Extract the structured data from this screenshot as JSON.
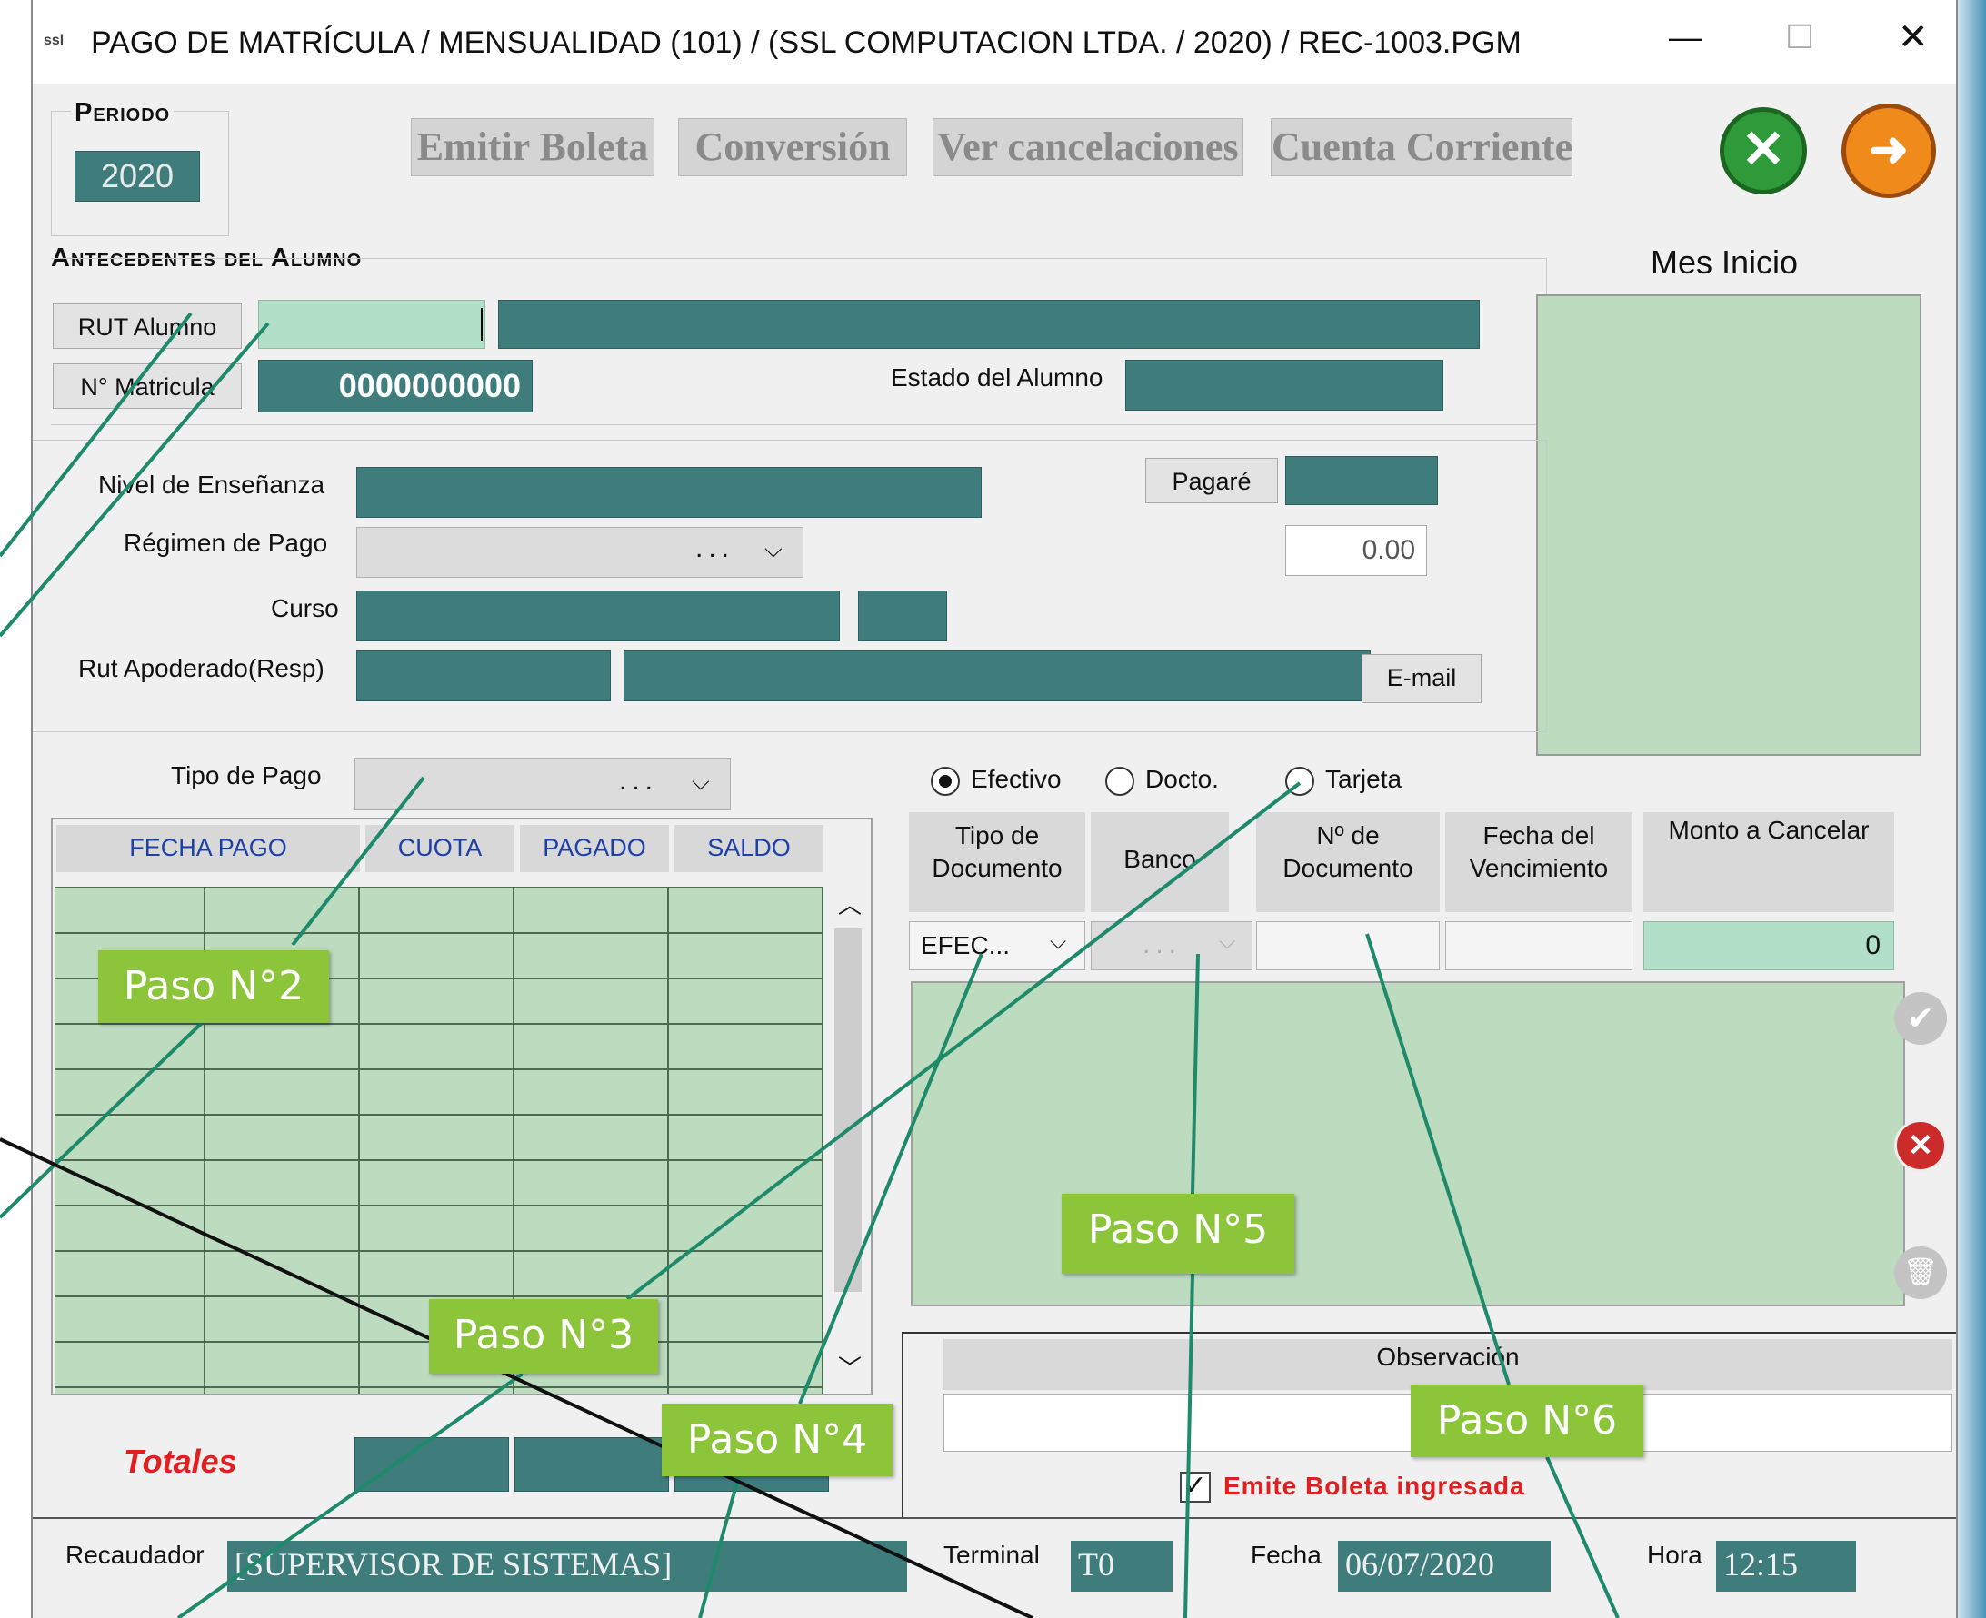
{
  "window": {
    "title": "PAGO DE MATRÍCULA / MENSUALIDAD (101) / (SSL COMPUTACION LTDA. / 2020) / REC-1003.PGM",
    "app_icon": "ssl-logo-icon",
    "controls": {
      "minimize": "—",
      "maximize": "☐",
      "close": "✕"
    }
  },
  "periodo": {
    "label": "Periodo",
    "value": "2020"
  },
  "toolbar": {
    "emitir_boleta": "Emitir Boleta",
    "conversion": "Conversión",
    "ver_cancelaciones": "Ver cancelaciones",
    "cuenta_corriente": "Cuenta Corriente"
  },
  "antecedentes": {
    "title": "Antecedentes del Alumno",
    "rut_label": "RUT Alumno",
    "rut_value": "",
    "matricula_label": "N° Matricula",
    "matricula_value": "0000000000",
    "estado_label": "Estado del Alumno"
  },
  "mes_inicio": {
    "label": "Mes Inicio"
  },
  "detalle": {
    "nivel_label": "Nivel de Enseñanza",
    "regimen_label": "Régimen de Pago",
    "regimen_value": "...",
    "curso_label": "Curso",
    "apoderado_label": "Rut Apoderado(Resp)",
    "pagare_label": "Pagaré",
    "monto_pagare": "0.00",
    "email_label": "E-mail"
  },
  "tipo_pago": {
    "label": "Tipo de Pago",
    "value": "..."
  },
  "cuotas_grid": {
    "headers": [
      "FECHA PAGO",
      "CUOTA",
      "PAGADO",
      "SALDO"
    ]
  },
  "totales_label": "Totales",
  "forma_pago": {
    "options": [
      "Efectivo",
      "Docto.",
      "Tarjeta"
    ],
    "selected": "Efectivo"
  },
  "documento": {
    "headers": [
      "Tipo de Documento",
      "Banco",
      "Nº de Documento",
      "Fecha del Vencimiento",
      "Monto a Cancelar"
    ],
    "tipo_value": "EFEC...",
    "banco_value": "...",
    "monto_value": "0"
  },
  "observacion": {
    "label": "Observación",
    "emite_boleta": "Emite Boleta ingresada"
  },
  "status_bar": {
    "recaudador_label": "Recaudador",
    "recaudador_value": "[SUPERVISOR DE SISTEMAS]",
    "terminal_label": "Terminal",
    "terminal_value": "T0",
    "fecha_label": "Fecha",
    "fecha_value": "06/07/2020",
    "hora_label": "Hora",
    "hora_value": "12:15"
  },
  "pasos": [
    "Paso N°2",
    "Paso N°3",
    "Paso N°4",
    "Paso N°5",
    "Paso N°6"
  ],
  "colors": {
    "teal": "#3e7d7c",
    "mint": "#b2dfc8",
    "paso_green": "#8cc43a",
    "totales_red": "#e02020"
  }
}
